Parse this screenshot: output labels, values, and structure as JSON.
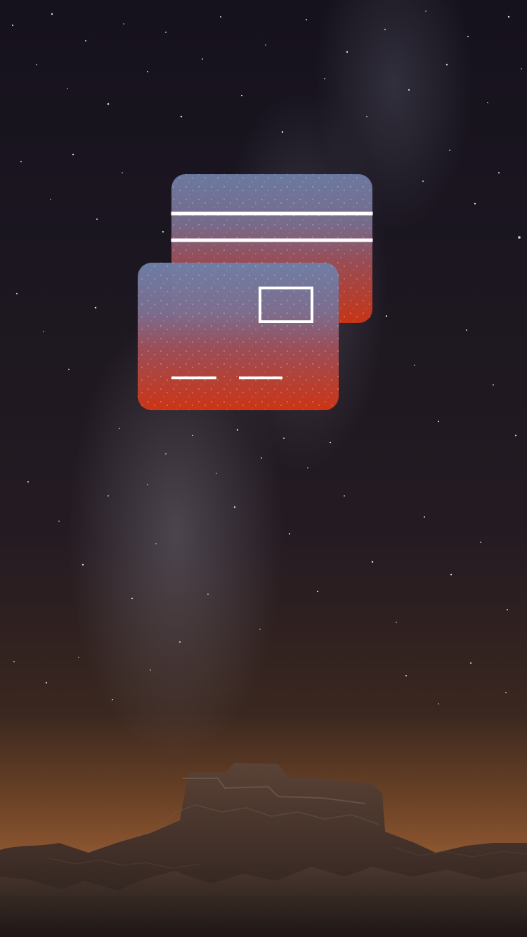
{
  "screen": {
    "background": "night-sky-milky-way-over-mesa",
    "icon": "credit-cards-icon"
  },
  "colors": {
    "sky_top": "#16121d",
    "horizon_glow": "#8c5630",
    "card_top": "#6f7ea6",
    "card_bottom": "#cf3514",
    "line": "#ffffff"
  }
}
